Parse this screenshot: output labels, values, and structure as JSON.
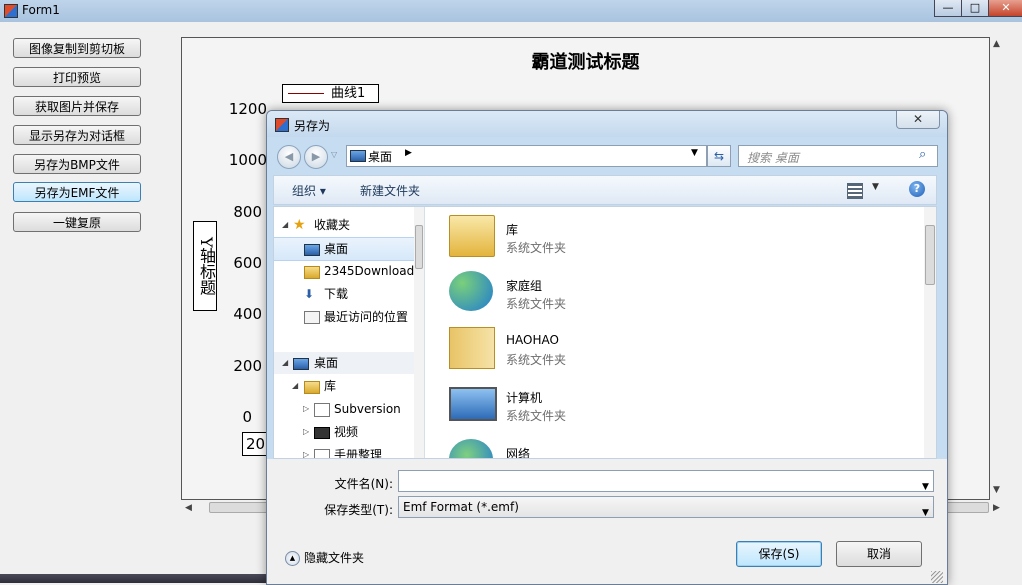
{
  "window": {
    "title": "Form1",
    "min": "—",
    "max": "□",
    "close": "✕"
  },
  "left_buttons": [
    "图像复制到剪切板",
    "打印预览",
    "获取图片并保存",
    "显示另存为对话框",
    "另存为BMP文件",
    "另存为EMF文件",
    "一键复原"
  ],
  "chart_data": {
    "type": "line",
    "title": "霸道测试标题",
    "ylabel": "Y轴标题",
    "yticks": [
      "1200",
      "1000",
      "800",
      "600",
      "400",
      "200",
      "0"
    ],
    "x_tick_partial": "20",
    "series": [
      {
        "name": "曲线1",
        "color": "#8b0000"
      }
    ]
  },
  "dialog": {
    "title": "另存为",
    "close": "✕",
    "address": "桌面",
    "search_placeholder": "搜索 桌面",
    "toolbar": {
      "organize": "组织 ▾",
      "new_folder": "新建文件夹"
    },
    "nav": [
      {
        "label": "收藏夹",
        "icon": "star-icon"
      },
      {
        "label": "桌面",
        "icon": "desktop-icon"
      },
      {
        "label": "2345Downloads",
        "icon": "folder-icon"
      },
      {
        "label": "下载",
        "icon": "download-icon"
      },
      {
        "label": "最近访问的位置",
        "icon": "recent-icon"
      },
      {
        "label": "桌面",
        "icon": "desktop-icon"
      },
      {
        "label": "库",
        "icon": "library-icon"
      },
      {
        "label": "Subversion",
        "icon": "document-icon"
      },
      {
        "label": "视频",
        "icon": "video-icon"
      },
      {
        "label": "手册整理",
        "icon": "document-icon"
      }
    ],
    "files": [
      {
        "name": "库",
        "type": "系统文件夹",
        "icon": "library-icon"
      },
      {
        "name": "家庭组",
        "type": "系统文件夹",
        "icon": "homegroup-icon"
      },
      {
        "name": "HAOHAO",
        "type": "系统文件夹",
        "icon": "user-folder-icon"
      },
      {
        "name": "计算机",
        "type": "系统文件夹",
        "icon": "computer-icon"
      },
      {
        "name": "网络",
        "type": "",
        "icon": "network-icon"
      }
    ],
    "filename_label": "文件名(N):",
    "filename_value": "",
    "filetype_label": "保存类型(T):",
    "filetype_value": "Emf Format (*.emf)",
    "hide_folders": "隐藏文件夹",
    "save": "保存(S)",
    "cancel": "取消"
  }
}
